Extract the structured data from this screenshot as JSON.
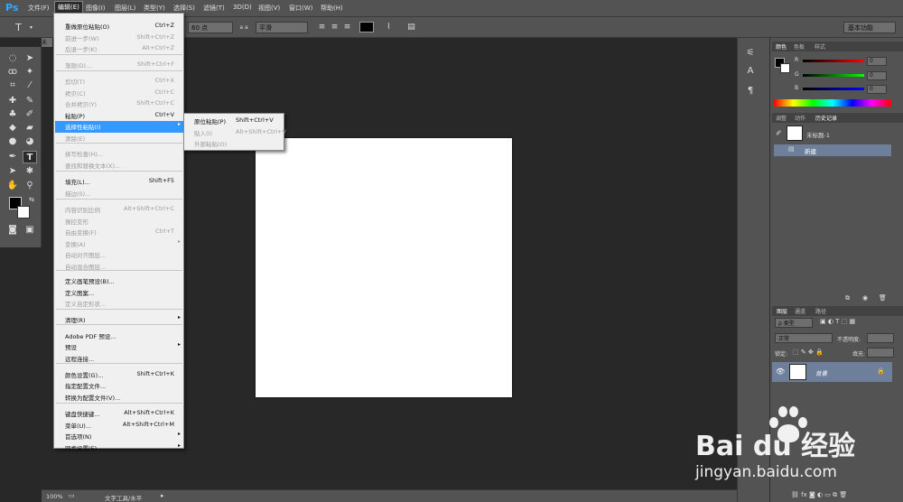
{
  "menubar": {
    "logo": "Ps",
    "items": [
      "文件(F)",
      "编辑(E)",
      "图像(I)",
      "图层(L)",
      "类型(Y)",
      "选择(S)",
      "滤镜(T)",
      "3D(D)",
      "视图(V)",
      "窗口(W)",
      "帮助(H)"
    ]
  },
  "optbar": {
    "tool_glyph": "T",
    "font_size": "60 点",
    "aa_label": "a a",
    "aa_mode": "平滑",
    "workspace": "基本功能"
  },
  "doc": {
    "tab_label": "未"
  },
  "status": {
    "zoom": "100%",
    "tool": "文字工具/水平"
  },
  "edit_menu": [
    {
      "label": "重做原位粘贴(O)",
      "sc": "Ctrl+Z"
    },
    {
      "label": "前进一步(W)",
      "sc": "Shift+Ctrl+Z",
      "disabled": true
    },
    {
      "label": "后退一步(K)",
      "sc": "Alt+Ctrl+Z",
      "disabled": true
    },
    {
      "label": "渐隐(D)...",
      "sc": "Shift+Ctrl+F",
      "disabled": true
    },
    {
      "label": "剪切(T)",
      "sc": "Ctrl+X",
      "disabled": true
    },
    {
      "label": "拷贝(C)",
      "sc": "Ctrl+C",
      "disabled": true
    },
    {
      "label": "合并拷贝(Y)",
      "sc": "Shift+Ctrl+C",
      "disabled": true
    },
    {
      "label": "粘贴(P)",
      "sc": "Ctrl+V"
    },
    {
      "label": "选择性粘贴(I)",
      "sc": "",
      "arrow": "▸",
      "highlighted": true
    },
    {
      "label": "清除(E)",
      "sc": "",
      "disabled": true
    },
    {
      "label": "拼写检查(H)...",
      "sc": "",
      "disabled": true
    },
    {
      "label": "查找和替换文本(X)...",
      "sc": "",
      "disabled": true
    },
    {
      "label": "填充(L)...",
      "sc": "Shift+F5"
    },
    {
      "label": "描边(S)...",
      "sc": "",
      "disabled": true
    },
    {
      "label": "内容识别比例",
      "sc": "Alt+Shift+Ctrl+C",
      "disabled": true
    },
    {
      "label": "操控变形",
      "sc": "",
      "disabled": true
    },
    {
      "label": "自由变换(F)",
      "sc": "Ctrl+T",
      "disabled": true
    },
    {
      "label": "变换(A)",
      "sc": "",
      "arrow": "▸",
      "disabled": true
    },
    {
      "label": "自动对齐图层...",
      "sc": "",
      "disabled": true
    },
    {
      "label": "自动混合图层...",
      "sc": "",
      "disabled": true
    },
    {
      "label": "定义画笔预设(B)...",
      "sc": ""
    },
    {
      "label": "定义图案...",
      "sc": ""
    },
    {
      "label": "定义自定形状...",
      "sc": "",
      "disabled": true
    },
    {
      "label": "清理(R)",
      "sc": "",
      "arrow": "▸"
    },
    {
      "label": "Adobe PDF 预设...",
      "sc": ""
    },
    {
      "label": "预设",
      "sc": "",
      "arrow": "▸"
    },
    {
      "label": "远程连接...",
      "sc": ""
    },
    {
      "label": "颜色设置(G)...",
      "sc": "Shift+Ctrl+K"
    },
    {
      "label": "指定配置文件...",
      "sc": ""
    },
    {
      "label": "转换为配置文件(V)...",
      "sc": ""
    },
    {
      "label": "键盘快捷键...",
      "sc": "Alt+Shift+Ctrl+K"
    },
    {
      "label": "菜单(U)...",
      "sc": "Alt+Shift+Ctrl+M"
    },
    {
      "label": "首选项(N)",
      "sc": "",
      "arrow": "▸"
    },
    {
      "label": "同步设置(E)",
      "sc": "",
      "arrow": "▸"
    }
  ],
  "paste_submenu": [
    {
      "label": "原位粘贴(P)",
      "sc": "Shift+Ctrl+V"
    },
    {
      "label": "贴入(I)",
      "sc": "Alt+Shift+Ctrl+V",
      "disabled": true
    },
    {
      "label": "外部粘贴(O)",
      "sc": "",
      "disabled": true
    }
  ],
  "color_panel": {
    "tabs": [
      "颜色",
      "色板",
      "样式"
    ],
    "channels": [
      {
        "name": "R",
        "value": "0"
      },
      {
        "name": "G",
        "value": "0"
      },
      {
        "name": "B",
        "value": "0"
      }
    ]
  },
  "history_panel": {
    "tabs": [
      "调整",
      "动作",
      "历史记录"
    ],
    "snapshot": "未标题-1",
    "step": "新建"
  },
  "layers_panel": {
    "tabs": [
      "图层",
      "通道",
      "路径"
    ],
    "filter": "ρ 类型",
    "blend": "正常",
    "opacity_label": "不透明度:",
    "lock_label": "锁定:",
    "fill_label": "填充:",
    "layer_name": "背景"
  },
  "watermark": {
    "brand": "Bai du 经验",
    "url": "jingyan.baidu.com"
  },
  "colors": {
    "accent": "#3399ff",
    "panel": "#535353",
    "canvas": "#ffffff",
    "selected_layer": "#6d7f9a"
  }
}
